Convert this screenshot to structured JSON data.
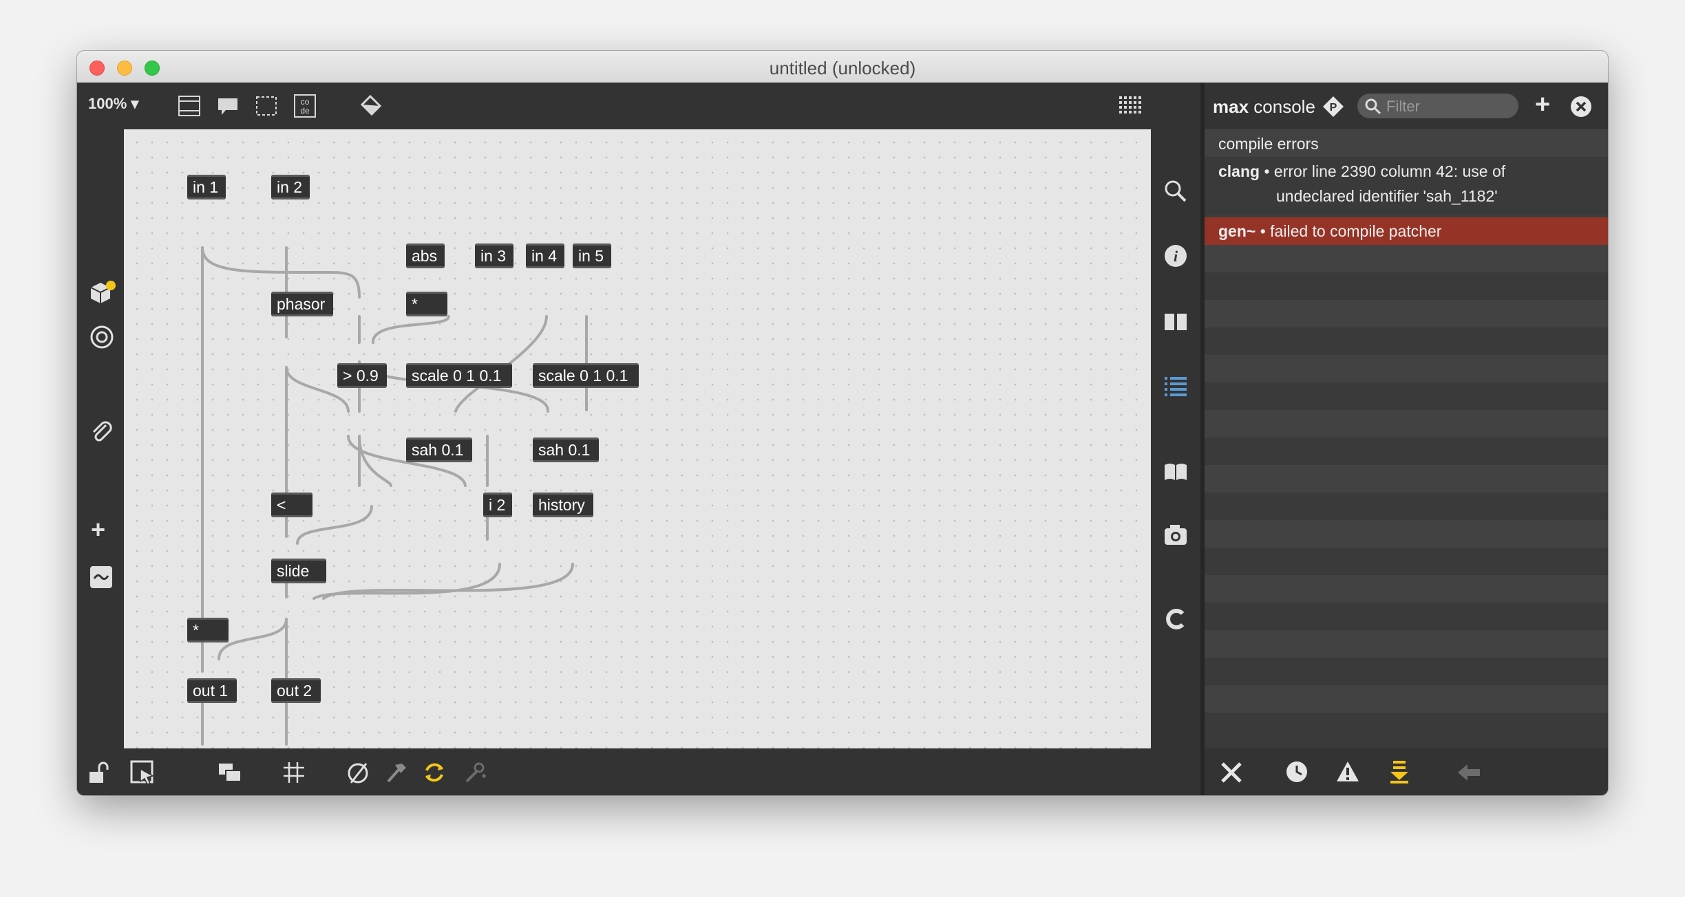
{
  "window": {
    "title": "untitled (unlocked)"
  },
  "patcher": {
    "zoom": "100%",
    "objects": {
      "in1": "in 1",
      "in2": "in 2",
      "abs": "abs",
      "in3": "in 3",
      "in4": "in 4",
      "in5": "in 5",
      "phasor": "phasor",
      "mul_top": "*",
      "gt": "> 0.9",
      "scale1": "scale 0 1 0.1",
      "scale2": "scale 0 1 0.1",
      "sah1": "sah 0.1",
      "sah2": "sah 0.1",
      "lt": "<",
      "i2": "i 2",
      "history": "history",
      "slide": "slide",
      "mul_bottom": "*",
      "out1": "out 1",
      "out2": "out 2"
    }
  },
  "console": {
    "title_bold": "max",
    "title_rest": "console",
    "filter_placeholder": "Filter",
    "messages": [
      {
        "source": "",
        "text": "compile errors"
      },
      {
        "source": "clang",
        "text": "• error line  2390 column 42: use of",
        "text2": "undeclared identifier 'sah_1182'"
      },
      {
        "source": "gen~",
        "text": "• failed to compile patcher",
        "error": true
      }
    ]
  },
  "colors": {
    "accent": "#5b9bd5",
    "error_row": "#963327",
    "toolbar": "#333333",
    "canvas": "#e6e6e6",
    "cord": "#a0a0a0"
  }
}
